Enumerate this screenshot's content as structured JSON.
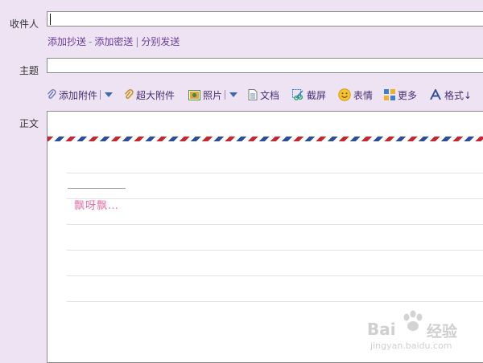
{
  "compose": {
    "to_label": "收件人",
    "to_value": "",
    "cc_links": [
      "添加抄送",
      "添加密送",
      "分别发送"
    ],
    "cc_separators": [
      "-",
      "|"
    ],
    "subject_label": "主题",
    "subject_value": "",
    "body_label": "正文",
    "signature": "飘呀飘…"
  },
  "toolbar": {
    "attach": "添加附件",
    "big_attach": "超大附件",
    "photo": "照片",
    "doc": "文档",
    "screenshot": "截屏",
    "emoji": "表情",
    "more": "更多",
    "format": "格式↓"
  },
  "watermark": {
    "brand": "Bai",
    "brand_suffix": "经验",
    "url": "jingyan.baidu.com"
  },
  "colors": {
    "background": "#ede3f2",
    "link": "#6a3d9a",
    "signature": "#e46ea9",
    "airmail_red": "#c8262e",
    "airmail_blue": "#2b4e9c"
  }
}
